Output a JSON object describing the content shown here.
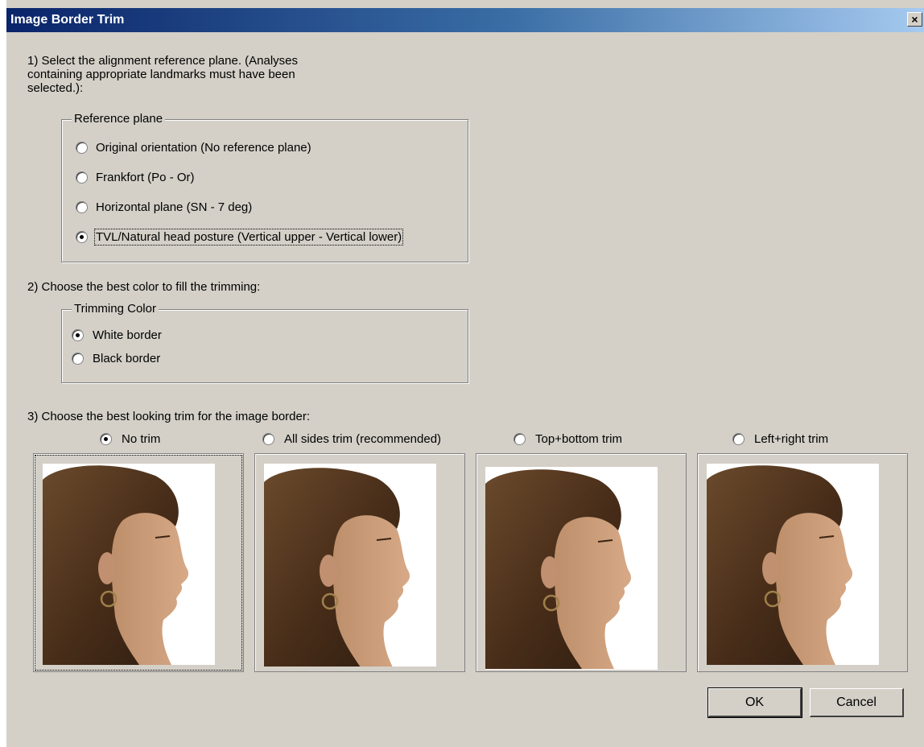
{
  "window": {
    "title": "Image Border Trim",
    "close_label": "×"
  },
  "step1": {
    "instruction": "1) Select the alignment reference plane. (Analyses containing appropriate landmarks must have been selected.):",
    "line1": "1) Select the alignment reference plane. (Analyses",
    "line2": "containing appropriate landmarks must have been",
    "line3": "selected.):",
    "group_label": "Reference plane",
    "options": [
      {
        "label": "Original orientation (No reference plane)",
        "selected": false
      },
      {
        "label": "Frankfort (Po - Or)",
        "selected": false
      },
      {
        "label": "Horizontal plane (SN - 7 deg)",
        "selected": false
      },
      {
        "label": "TVL/Natural head posture (Vertical upper - Vertical lower)",
        "selected": true
      }
    ]
  },
  "step2": {
    "instruction": "2) Choose the best color to fill the trimming:",
    "group_label": "Trimming Color",
    "options": [
      {
        "label": "White border",
        "selected": true
      },
      {
        "label": "Black border",
        "selected": false
      }
    ]
  },
  "step3": {
    "instruction": "3) Choose the best looking trim for the image border:",
    "options": [
      {
        "label": "No trim",
        "selected": true
      },
      {
        "label": "All sides trim (recommended)",
        "selected": false
      },
      {
        "label": "Top+bottom trim",
        "selected": false
      },
      {
        "label": "Left+right trim",
        "selected": false
      }
    ]
  },
  "buttons": {
    "ok": "OK",
    "cancel": "Cancel"
  }
}
